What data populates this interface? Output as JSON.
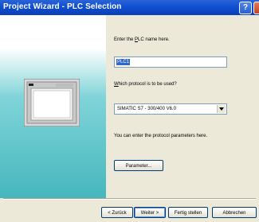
{
  "window": {
    "title": "Project Wizard - PLC Selection",
    "help_glyph": "?"
  },
  "form": {
    "name_prompt_pre": "Enter the ",
    "name_prompt_key": "P",
    "name_prompt_post": "LC name here.",
    "name_value": "PLC1",
    "protocol_prompt_key": "W",
    "protocol_prompt_post": "hich protocol is to be used?",
    "protocol_value": "SIMATIC S7 - 300/400  V6.0",
    "params_hint": "You can enter the protocol parameters here.",
    "params_button": "Parameter..."
  },
  "footer": {
    "back": "< Zurück",
    "next": "Weiter >",
    "finish": "Fertig stellen",
    "cancel": "Abbrechen"
  },
  "colors": {
    "title_bar": "#0f4fd0",
    "panel_teal": "#45b7bd",
    "selection": "#316ac5"
  }
}
